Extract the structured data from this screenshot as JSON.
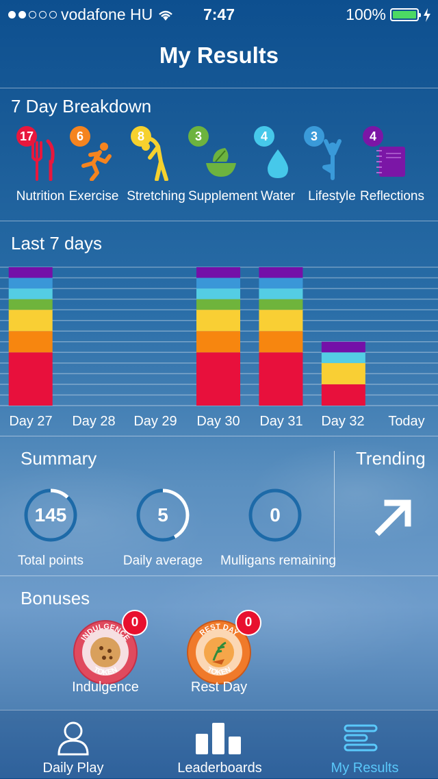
{
  "status_bar": {
    "carrier": "vodafone HU",
    "time": "7:47",
    "battery": "100%"
  },
  "title": "My Results",
  "breakdown": {
    "title": "7 Day Breakdown",
    "categories": [
      {
        "label": "Nutrition",
        "count": "17",
        "color": "#e8173d",
        "icon": "fork-knife-icon"
      },
      {
        "label": "Exercise",
        "count": "6",
        "color": "#f5841f",
        "icon": "runner-icon"
      },
      {
        "label": "Stretching",
        "count": "8",
        "color": "#f6d12e",
        "icon": "stretching-person-icon"
      },
      {
        "label": "Supplement",
        "count": "3",
        "color": "#6db33f",
        "icon": "supplement-bowl-icon"
      },
      {
        "label": "Water",
        "count": "4",
        "color": "#46c8ea",
        "icon": "water-drop-icon"
      },
      {
        "label": "Lifestyle",
        "count": "3",
        "color": "#3a9ad9",
        "icon": "yoga-person-icon"
      },
      {
        "label": "Reflections",
        "count": "4",
        "color": "#7b16a6",
        "icon": "notebook-icon"
      }
    ]
  },
  "last7": {
    "title": "Last 7 days",
    "chart_data": {
      "type": "bar",
      "categories": [
        "Day 27",
        "Day 28",
        "Day 29",
        "Day 30",
        "Day 31",
        "Day 32",
        "Today"
      ],
      "series": [
        {
          "color": "#e8103c",
          "values": [
            5,
            0,
            0,
            5,
            5,
            2
          ]
        },
        {
          "color": "#f7860f",
          "values": [
            2,
            0,
            0,
            2,
            2,
            0
          ]
        },
        {
          "color": "#f9cf34",
          "values": [
            2,
            0,
            0,
            2,
            2,
            2
          ]
        },
        {
          "color": "#6fb43c",
          "values": [
            1,
            0,
            0,
            1,
            1,
            0
          ]
        },
        {
          "color": "#54cde4",
          "values": [
            1,
            0,
            0,
            1,
            1,
            1
          ]
        },
        {
          "color": "#3a97d8",
          "values": [
            1,
            0,
            0,
            1,
            1,
            0
          ]
        },
        {
          "color": "#7410a8",
          "values": [
            1,
            0,
            0,
            1,
            1,
            1
          ]
        }
      ],
      "ylim": [
        0,
        13
      ],
      "grid": true
    }
  },
  "summary": {
    "title": "Summary",
    "total_points": {
      "value": "145",
      "label": "Total points",
      "fraction": 0.12
    },
    "daily_average": {
      "value": "5",
      "label": "Daily average",
      "fraction": 0.42
    },
    "mulligans": {
      "value": "0",
      "label": "Mulligans remaining",
      "fraction": 0
    }
  },
  "trending": {
    "title": "Trending",
    "icon": "arrow-up-right-icon"
  },
  "bonuses": {
    "title": "Bonuses",
    "items": [
      {
        "label": "Indulgence",
        "count": "0",
        "token_top": "INDULGENCE",
        "token_bottom": "TOKEN",
        "color": "#e04a5e"
      },
      {
        "label": "Rest Day",
        "count": "0",
        "token_top": "REST DAY",
        "token_bottom": "TOKEN",
        "color": "#f07a2a"
      }
    ]
  },
  "tabs": [
    {
      "label": "Daily Play",
      "icon": "person-icon",
      "active": false
    },
    {
      "label": "Leaderboards",
      "icon": "bar-chart-icon",
      "active": false
    },
    {
      "label": "My Results",
      "icon": "results-lines-icon",
      "active": true
    }
  ],
  "colors": {
    "active_tab": "#5ac8fa",
    "ring_track": "#1d6aa8",
    "ring_fill": "#ffffff"
  }
}
